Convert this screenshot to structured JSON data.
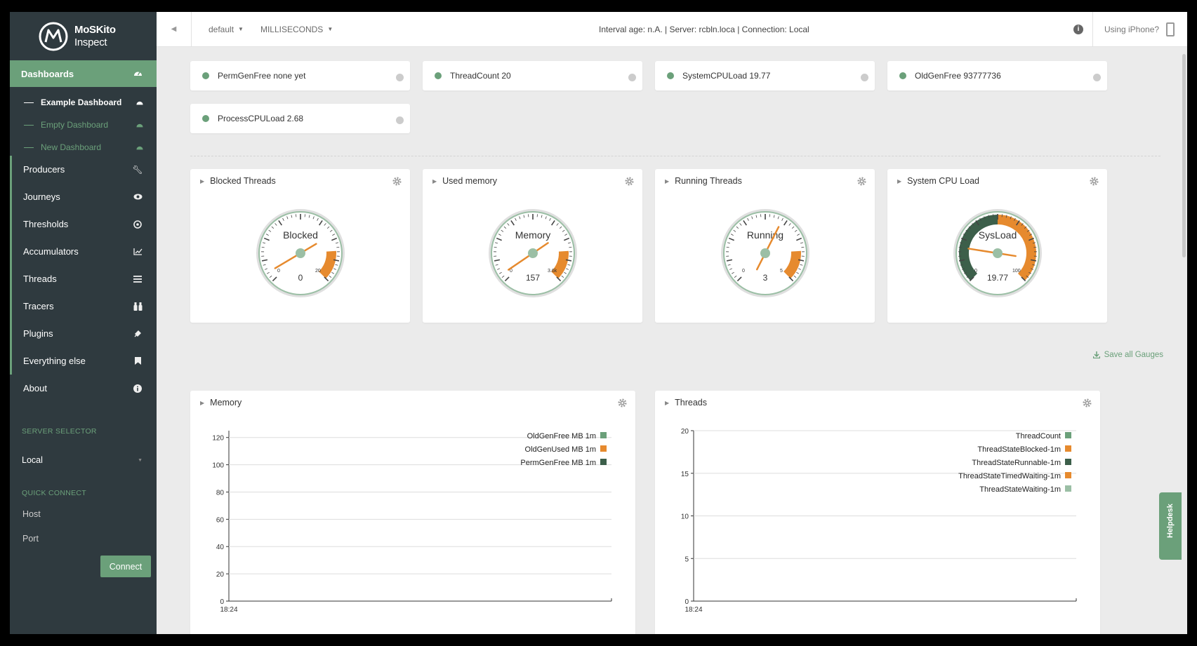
{
  "brand": {
    "name": "MoSKito",
    "sub": "Inspect"
  },
  "sidebar": {
    "active": "Dashboards",
    "dashboards": [
      "Example Dashboard",
      "Empty Dashboard",
      "New Dashboard"
    ],
    "items": [
      "Producers",
      "Journeys",
      "Thresholds",
      "Accumulators",
      "Threads",
      "Tracers",
      "Plugins",
      "Everything else",
      "About"
    ],
    "server_selector_label": "SERVER SELECTOR",
    "server_value": "Local",
    "quick_connect_label": "QUICK CONNECT",
    "host_placeholder": "Host",
    "port_placeholder": "Port",
    "connect_label": "Connect"
  },
  "topbar": {
    "dd1": "default",
    "dd2": "MILLISECONDS",
    "status": "Interval age: n.A. | Server: rcbln.loca | Connection: Local",
    "iphone": "Using iPhone?"
  },
  "thresholds": [
    {
      "name": "PermGenFree none yet"
    },
    {
      "name": "ThreadCount 20"
    },
    {
      "name": "SystemCPULoad 19.77"
    },
    {
      "name": "OldGenFree 93777736"
    },
    {
      "name": "ProcessCPULoad 2.68"
    }
  ],
  "gauges": [
    {
      "title": "Blocked Threads",
      "label": "Blocked",
      "value": "0",
      "min": "0",
      "max": "20",
      "fraction": 0.0
    },
    {
      "title": "Used memory",
      "label": "Memory",
      "value": "157",
      "min": "0",
      "max": "3.6k",
      "fraction": 0.04
    },
    {
      "title": "Running Threads",
      "label": "Running",
      "value": "3",
      "min": "0",
      "max": "5",
      "fraction": 0.6
    },
    {
      "title": "System CPU Load",
      "label": "SysLoad",
      "value": "19.77",
      "min": "0",
      "max": "100",
      "fraction": 0.2
    }
  ],
  "save_all": "Save all Gauges",
  "colors": {
    "accent": "#6ba07a",
    "orange": "#e68a2e",
    "dark_green": "#3c5f4a"
  },
  "chart_data": [
    {
      "type": "line",
      "title": "Memory",
      "x": [
        "18:24"
      ],
      "yticks": [
        0,
        20,
        40,
        60,
        80,
        100,
        120
      ],
      "ylim": [
        0,
        125
      ],
      "legend": "top-right",
      "series": [
        {
          "name": "OldGenFree MB 1m",
          "color": "#6ba07a",
          "values": []
        },
        {
          "name": "OldGenUsed MB 1m",
          "color": "#e68a2e",
          "values": []
        },
        {
          "name": "PermGenFree MB 1m",
          "color": "#3c5f4a",
          "values": []
        }
      ]
    },
    {
      "type": "line",
      "title": "Threads",
      "x": [
        "18:24"
      ],
      "yticks": [
        0,
        5,
        10,
        15,
        20
      ],
      "ylim": [
        0,
        20
      ],
      "legend": "top-right",
      "series": [
        {
          "name": "ThreadCount",
          "color": "#6ba07a",
          "values": []
        },
        {
          "name": "ThreadStateBlocked-1m",
          "color": "#e68a2e",
          "values": []
        },
        {
          "name": "ThreadStateRunnable-1m",
          "color": "#3c5f4a",
          "values": []
        },
        {
          "name": "ThreadStateTimedWaiting-1m",
          "color": "#e68a2e",
          "values": []
        },
        {
          "name": "ThreadStateWaiting-1m",
          "color": "#9bbfa5",
          "values": []
        }
      ]
    }
  ],
  "helpdesk": "Helpdesk"
}
